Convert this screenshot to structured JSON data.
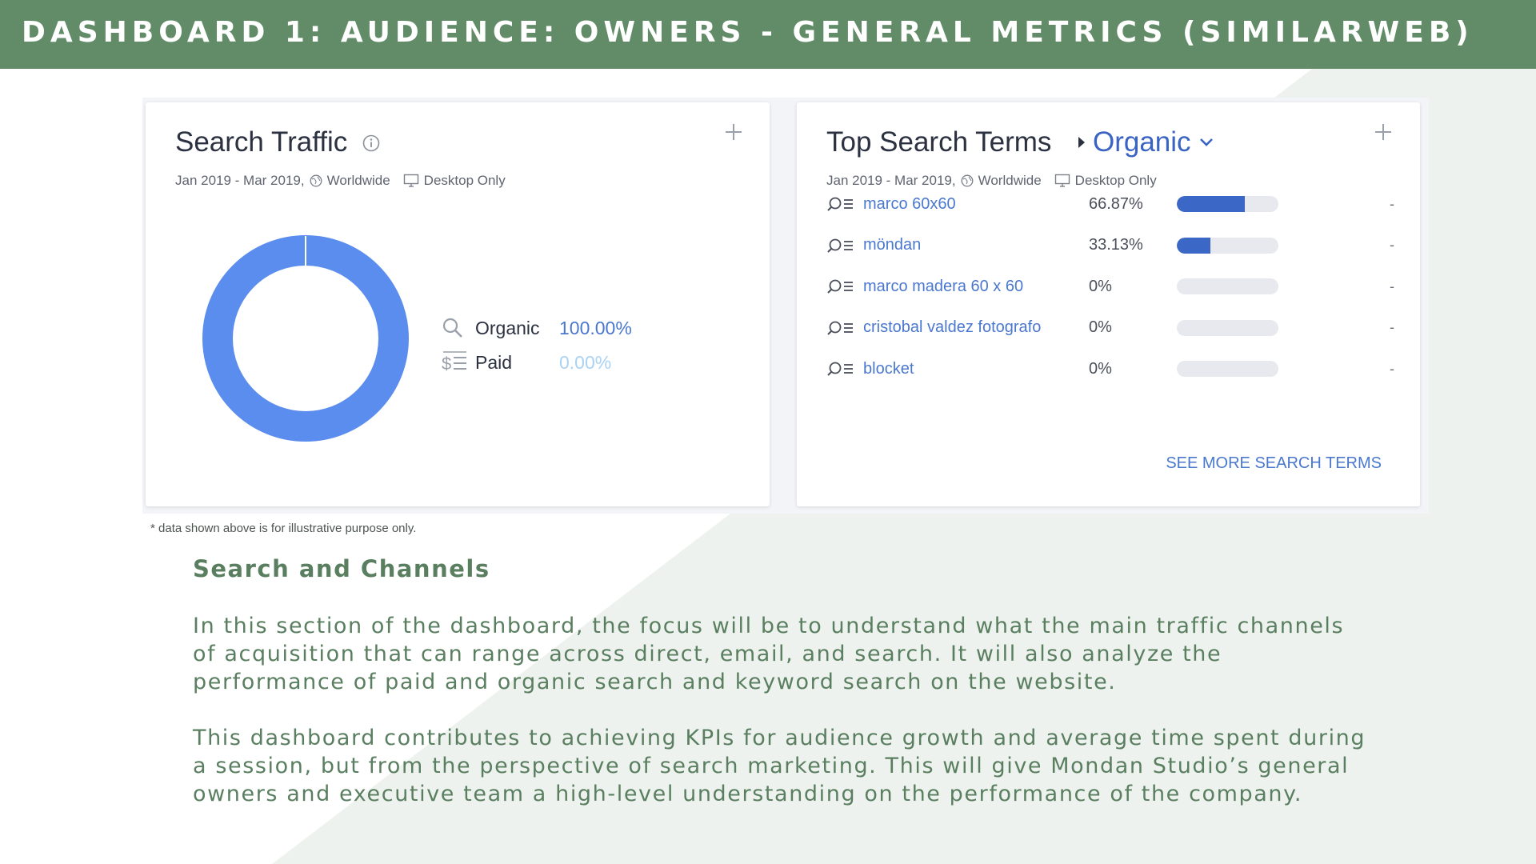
{
  "banner": {
    "title": "DASHBOARD 1: AUDIENCE: OWNERS - GENERAL METRICS (SIMILARWEB)"
  },
  "colors": {
    "banner": "#618c67",
    "accent_green_text": "#5a7f60",
    "donut_blue": "#5b8def",
    "link_blue": "#4a78cf",
    "bar_blue": "#3b67c6",
    "paid_light_blue": "#a9d3f5"
  },
  "search_traffic": {
    "title": "Search Traffic",
    "info_icon": "info-icon",
    "plus_icon": "plus-icon",
    "date_range": "Jan 2019 - Mar 2019,",
    "region": "Worldwide",
    "device": "Desktop Only",
    "legend": [
      {
        "icon": "search-icon",
        "label": "Organic",
        "value": "100.00%"
      },
      {
        "icon": "paid-search-icon",
        "label": "Paid",
        "value": "0.00%"
      }
    ],
    "donut_fraction_organic": 1.0
  },
  "top_search_terms": {
    "title": "Top Search Terms",
    "filter_selected": "Organic",
    "plus_icon": "plus-icon",
    "date_range": "Jan 2019 - Mar 2019,",
    "region": "Worldwide",
    "device": "Desktop Only",
    "terms": [
      {
        "name": "marco 60x60",
        "share": "66.87%",
        "fraction": 0.6687,
        "change": "-"
      },
      {
        "name": "möndan",
        "share": "33.13%",
        "fraction": 0.3313,
        "change": "-"
      },
      {
        "name": "marco madera 60 x 60",
        "share": "0%",
        "fraction": 0,
        "change": "-"
      },
      {
        "name": "cristobal valdez fotografo",
        "share": "0%",
        "fraction": 0,
        "change": "-"
      },
      {
        "name": "blocket",
        "share": "0%",
        "fraction": 0,
        "change": "-"
      }
    ],
    "see_more": "SEE MORE SEARCH TERMS"
  },
  "footnote": "* data shown above is for illustrative purpose only.",
  "section": {
    "title": "Search and Channels",
    "paragraph1": "In this section of the dashboard, the focus will be to understand what the main traffic channels of acquisition that can range across direct, email, and search. It will also analyze the performance of paid and organic search and keyword search on the website.",
    "paragraph2": "This dashboard contributes to achieving KPIs for audience growth and average time spent during a session, but from the perspective of search marketing. This will give Mondan Studio’s general owners and executive team a high-level understanding on the performance of the company."
  }
}
